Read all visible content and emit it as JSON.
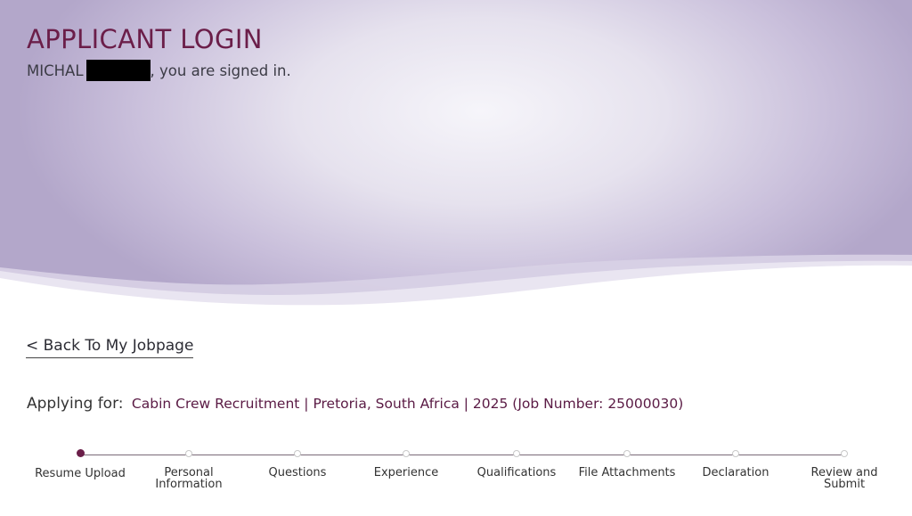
{
  "header": {
    "title": "APPLICANT LOGIN",
    "user_first_name": "MICHAL",
    "signed_in_suffix": ", you are signed in."
  },
  "nav": {
    "back_link": "< Back To My Jobpage"
  },
  "application": {
    "label": "Applying for:",
    "job": "Cabin Crew Recruitment | Pretoria, South Africa | 2025 (Job Number: 25000030)"
  },
  "steps": [
    {
      "label": "Resume Upload",
      "active": true
    },
    {
      "label": "Personal Information",
      "active": false
    },
    {
      "label": "Questions",
      "active": false
    },
    {
      "label": "Experience",
      "active": false
    },
    {
      "label": "Qualifications",
      "active": false
    },
    {
      "label": "File Attachments",
      "active": false
    },
    {
      "label": "Declaration",
      "active": false
    },
    {
      "label": "Review and Submit",
      "active": false
    }
  ],
  "colors": {
    "brand": "#6b1e49",
    "hero_light": "#f6f5fa",
    "hero_dark": "#b3a7ca"
  }
}
